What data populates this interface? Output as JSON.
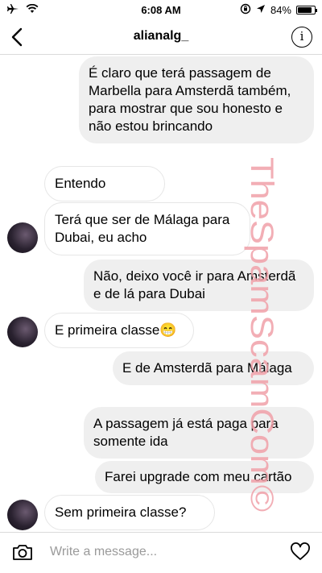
{
  "status_bar": {
    "time": "6:08 AM",
    "battery": "84%",
    "battery_level": 0.84,
    "icons": [
      "airplane-icon",
      "wifi-icon",
      "orientation-lock-icon",
      "location-arrow-icon",
      "battery-icon"
    ]
  },
  "header": {
    "title": "alianalg_",
    "back_icon": "chevron-left-icon",
    "info_icon": "info-icon",
    "info_glyph": "i"
  },
  "messages": [
    {
      "side": "out",
      "text": "É claro que terá passagem de Marbella para Amsterdã também, para mostrar que sou honesto e não estou brincando"
    },
    {
      "side": "in",
      "text": "Entendo"
    },
    {
      "side": "in",
      "text": "Terá que ser de Málaga para Dubai, eu acho"
    },
    {
      "side": "out",
      "text": "Não, deixo você ir para Amsterdã e de lá para Dubai"
    },
    {
      "side": "in",
      "text": "E primeira classe😁"
    },
    {
      "side": "out",
      "text": "E de Amsterdã para Málaga"
    },
    {
      "side": "out",
      "text": "A passagem já está paga para somente ida"
    },
    {
      "side": "out",
      "text": "Farei upgrade com meu cartão"
    },
    {
      "side": "in",
      "text": "Sem primeira classe?"
    }
  ],
  "watermark": {
    "text": "TheSpamScamCom©",
    "color": "#f0a0a8"
  },
  "composer": {
    "placeholder": "Write a message...",
    "camera_icon": "camera-icon",
    "heart_icon": "heart-icon"
  },
  "colors": {
    "outgoing_bubble": "#efefef",
    "incoming_border": "#e6e6e6",
    "divider": "#dbdbdb"
  }
}
